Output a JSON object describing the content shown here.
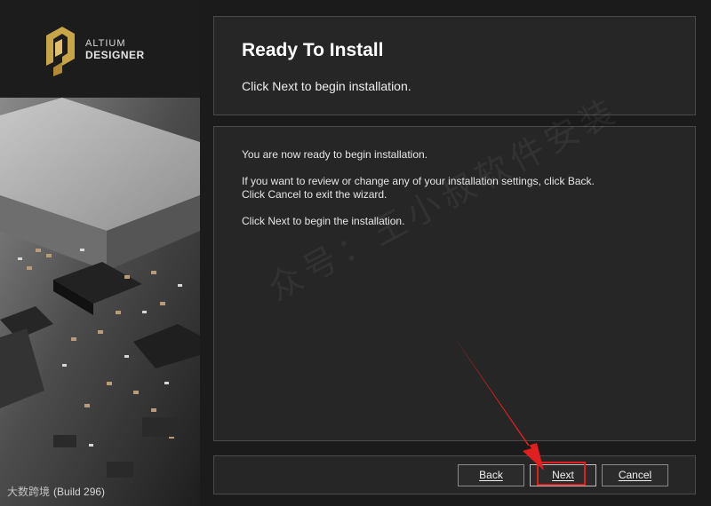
{
  "brand": {
    "line1": "ALTIUM",
    "line2": "DESIGNER",
    "accent_color": "#c9a54a",
    "icon": "altium-logo-icon"
  },
  "sidebar": {
    "build": "(Build 296)",
    "watermark_prefix": "大数跨境"
  },
  "header": {
    "title": "Ready To Install",
    "subtitle": "Click Next to begin installation."
  },
  "body": {
    "line1": "You are now ready to begin installation.",
    "line2": "If you want to review or change any of your installation settings, click Back.",
    "line3": "Click Cancel to exit the wizard.",
    "line4": "Click Next to begin the installation."
  },
  "buttons": {
    "back": "Back",
    "next": "Next",
    "cancel": "Cancel"
  },
  "overlay": {
    "watermark_text": "众号：王小叔软件安装",
    "highlight_color": "#e02020"
  }
}
